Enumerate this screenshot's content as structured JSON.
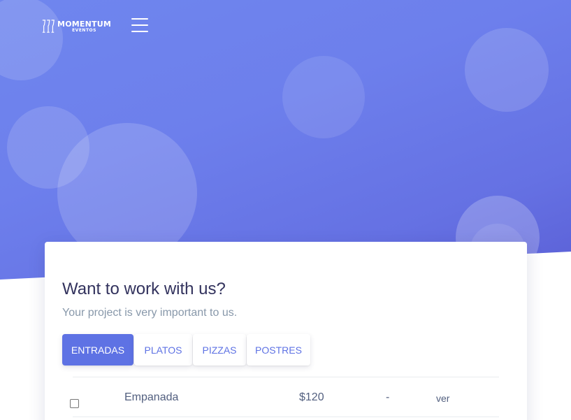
{
  "brand": {
    "name": "MOMENTUM",
    "sub": "EVENTOS"
  },
  "colors": {
    "accent": "#5e72e4",
    "hero_start": "#6f86ee",
    "hero_end": "#5a5ed5"
  },
  "icons": {
    "menu": "hamburger-icon",
    "logo": "wine-glasses-logo"
  },
  "card": {
    "title": "Want to work with us?",
    "subtitle": "Your project is very important to us.",
    "tabs": [
      {
        "label": "ENTRADAS",
        "active": true
      },
      {
        "label": "PLATOS",
        "active": false
      },
      {
        "label": "PIZZAS",
        "active": false
      },
      {
        "label": "POSTRES",
        "active": false
      }
    ],
    "rows": [
      {
        "checked": false,
        "name": "Empanada",
        "price": "$120",
        "extra": "-",
        "action": "ver"
      }
    ]
  }
}
